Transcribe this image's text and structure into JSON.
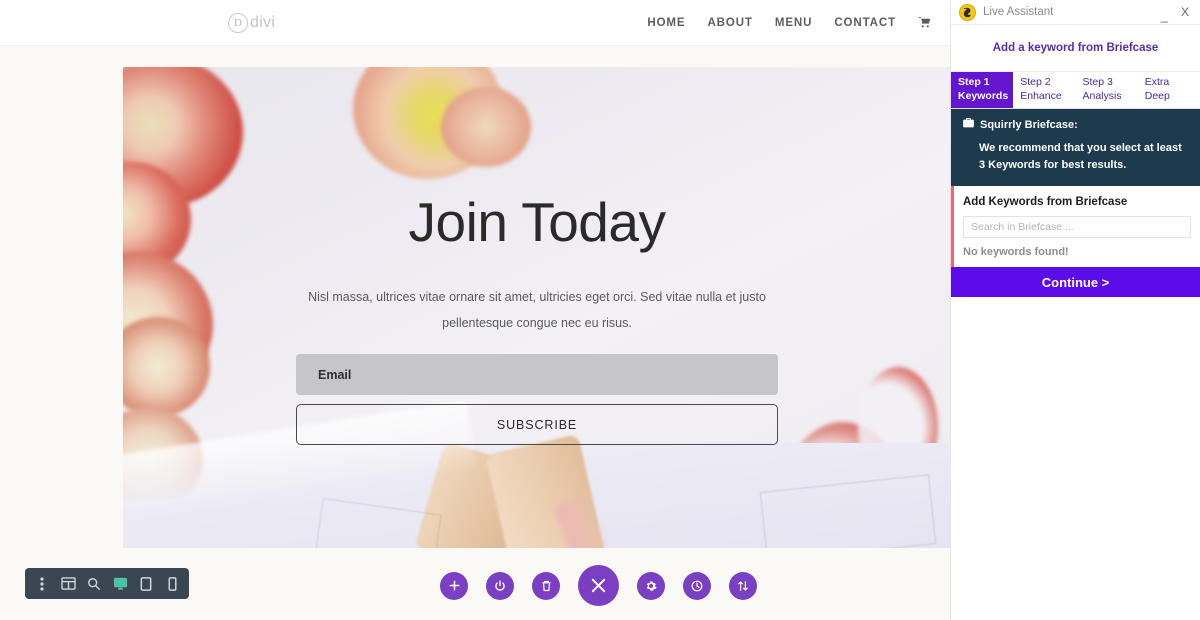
{
  "site": {
    "logo_text": "divi",
    "logo_mark": "D",
    "nav": [
      {
        "label": "HOME"
      },
      {
        "label": "ABOUT"
      },
      {
        "label": "MENU"
      },
      {
        "label": "CONTACT"
      }
    ],
    "cart_icon": "shopping-cart-icon",
    "hero": {
      "title": "Join Today",
      "subtitle": "Nisl massa, ultrices vitae ornare sit amet, ultricies eget orci. Sed vitae nulla et justo pellentesque congue nec eu risus.",
      "email_label": "Email",
      "email_placeholder": "Email",
      "subscribe_label": "SUBSCRIBE"
    }
  },
  "builder": {
    "left_toolbar": [
      {
        "name": "more-options-icon",
        "title": "More Options"
      },
      {
        "name": "wireframe-view-icon",
        "title": "Wireframe View"
      },
      {
        "name": "zoom-out-view-icon",
        "title": "Zoom Out"
      },
      {
        "name": "desktop-view-icon",
        "title": "Desktop View"
      },
      {
        "name": "tablet-view-icon",
        "title": "Tablet View"
      },
      {
        "name": "phone-view-icon",
        "title": "Phone View"
      }
    ],
    "active_view": "desktop-view-icon",
    "round_buttons": [
      {
        "name": "add-section-icon",
        "title": "Add Section"
      },
      {
        "name": "power-toggle-icon",
        "title": "Enable/Disable Builder"
      },
      {
        "name": "trash-icon",
        "title": "Delete"
      },
      {
        "name": "close-icon",
        "title": "Close"
      },
      {
        "name": "settings-gear-icon",
        "title": "Settings"
      },
      {
        "name": "history-clock-icon",
        "title": "Editing History"
      },
      {
        "name": "portability-icon",
        "title": "Portability"
      }
    ]
  },
  "panel": {
    "title": "Live Assistant",
    "logo_icon": "squirrly-logo-icon",
    "minimize_label": "_",
    "close_label": "X",
    "briefcase_link": "Add a keyword from Briefcase",
    "tabs": [
      {
        "step": "Step 1",
        "name": "Keywords",
        "active": true
      },
      {
        "step": "Step 2",
        "name": "Enhance",
        "active": false
      },
      {
        "step": "Step 3",
        "name": "Analysis",
        "active": false
      },
      {
        "step": "Extra",
        "name": "Deep",
        "active": false
      }
    ],
    "notice": {
      "icon": "briefcase-icon",
      "heading": "Squirrly Briefcase:",
      "body": "We recommend that you select at least 3 Keywords for best results."
    },
    "briefcase_section": {
      "title": "Add Keywords from Briefcase",
      "search_placeholder": "Search in Briefcase ...",
      "search_value": "",
      "empty_message": "No keywords found!"
    },
    "continue_label": "Continue >"
  },
  "colors": {
    "accent_purple": "#6515cf",
    "continue_violet": "#5b0ce8",
    "notice_navy": "#1e3a4d",
    "builder_purple": "#7b3fc4",
    "toolbar_slate": "#3a4752",
    "active_teal": "#4fc1a6",
    "section_red": "#e8686f",
    "squirrly_gold": "#f5c518"
  }
}
